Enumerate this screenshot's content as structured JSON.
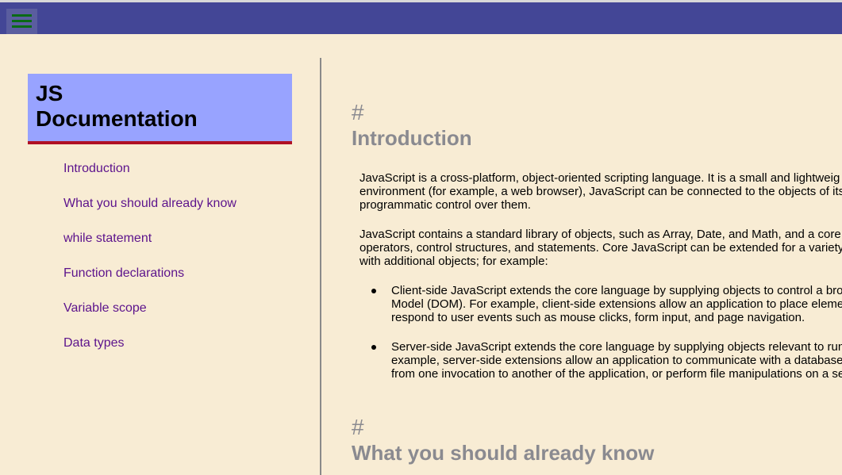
{
  "topbar": {
    "menu_icon": "hamburger-menu-icon",
    "colors": {
      "bar": "#434696",
      "menu_lines": "#0a6a16"
    }
  },
  "sidebar": {
    "title_line1": "JS",
    "title_line2": "Documentation",
    "items": [
      {
        "label": "Introduction"
      },
      {
        "label": "What you should already know"
      },
      {
        "label": "while statement"
      },
      {
        "label": "Function declarations"
      },
      {
        "label": "Variable scope"
      },
      {
        "label": "Data types"
      }
    ],
    "colors": {
      "header_bg": "#98a3ff",
      "header_border": "#b01124",
      "link": "#5c138c"
    }
  },
  "main": {
    "sections": [
      {
        "hash": "#",
        "title": "Introduction",
        "paragraphs": [
          [
            "JavaScript is a cross-platform, object-oriented scripting language. It is a small and lightweig",
            "environment (for example, a web browser), JavaScript can be connected to the objects of its",
            "programmatic control over them."
          ],
          [
            "JavaScript contains a standard library of objects, such as Array, Date, and Math, and a core",
            "operators, control structures, and statements. Core JavaScript can be extended for a variety",
            "with additional objects; for example:"
          ]
        ],
        "bullets": [
          [
            "Client-side JavaScript extends the core language by supplying objects to control a bro",
            "Model (DOM). For example, client-side extensions allow an application to place eleme",
            "respond to user events such as mouse clicks, form input, and page navigation."
          ],
          [
            "Server-side JavaScript extends the core language by supplying objects relevant to run",
            "example, server-side extensions allow an application to communicate with a database",
            "from one invocation to another of the application, or perform file manipulations on a se"
          ]
        ]
      },
      {
        "hash": "#",
        "title": "What you should already know"
      }
    ],
    "colors": {
      "heading": "#8a8a90",
      "page_bg": "#f8ecd4"
    }
  }
}
